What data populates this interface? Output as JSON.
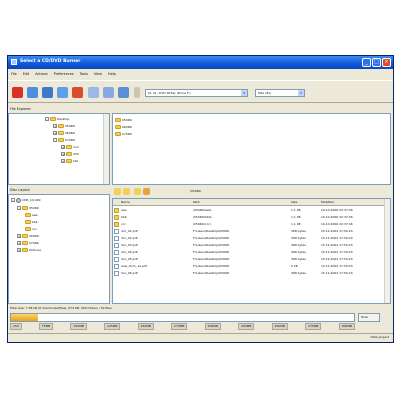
{
  "window": {
    "title": "Select a CD/DVD Burner"
  },
  "menu": [
    "File",
    "Edit",
    "Actions",
    "Preferences",
    "Tools",
    "View",
    "Help"
  ],
  "toolbar": {
    "drive_combo": "[0, 0] - DVD Writer (Drive F:)",
    "speed_combo": "Max (8x)"
  },
  "file_explorer": {
    "title": "File Explorer",
    "tree": [
      {
        "label": "Desktop",
        "level": 0
      },
      {
        "label": "0506D",
        "level": 1
      },
      {
        "label": "0606D",
        "level": 1
      },
      {
        "label": "0706D",
        "level": 1
      },
      {
        "label": "nnn",
        "level": 2
      },
      {
        "label": "ddd",
        "level": 2
      },
      {
        "label": "kkk",
        "level": 2
      }
    ],
    "files": [
      "0506D",
      "0606D",
      "0706D"
    ]
  },
  "disc_layout": {
    "title": "Disc Layout",
    "path": "\\0506D",
    "tree": [
      {
        "label": "CDR_1/1409",
        "level": 0
      },
      {
        "label": "0506D",
        "level": 1
      },
      {
        "label": "aaa",
        "level": 2
      },
      {
        "label": "bbb",
        "level": 2
      },
      {
        "label": "ccc",
        "level": 2
      },
      {
        "label": "0606D",
        "level": 1
      },
      {
        "label": "0706D",
        "level": 1
      },
      {
        "label": "Pictures",
        "level": 1
      }
    ],
    "columns": [
      "Name",
      "Path",
      "Size",
      "Modified"
    ],
    "rows": [
      {
        "name": "aaa",
        "path": "\\0506D\\aaa\\",
        "size": "1.1 kB",
        "modified": "10.10.2006 22:37:46"
      },
      {
        "name": "bbb",
        "path": "\\0506D\\bbb\\",
        "size": "1.1 kB",
        "modified": "10.10.2006 22:37:46"
      },
      {
        "name": "ccc",
        "path": "\\0506D\\ccc\\",
        "size": "1.1 kB",
        "modified": "10.10.2006 22:37:46"
      },
      {
        "name": "doc_01.pdf",
        "path": "F:\\Users\\Desktop\\0506D",
        "size": "368 bytes",
        "modified": "15.12.2004 17:50:24"
      },
      {
        "name": "doc_02.pdf",
        "path": "F:\\Users\\Desktop\\0506D",
        "size": "368 bytes",
        "modified": "15.12.2004 17:50:24"
      },
      {
        "name": "doc_03.pdf",
        "path": "F:\\Users\\Desktop\\0506D",
        "size": "368 bytes",
        "modified": "15.12.2004 17:50:24"
      },
      {
        "name": "doc_04.pdf",
        "path": "F:\\Users\\Desktop\\0506D",
        "size": "368 bytes",
        "modified": "15.12.2004 17:50:24"
      },
      {
        "name": "doc_05.pdf",
        "path": "F:\\Users\\Desktop\\0506D",
        "size": "368 bytes",
        "modified": "15.12.2004 17:50:24"
      },
      {
        "name": "new_form_1a.pdf",
        "path": "F:\\Users\\Desktop\\0506D",
        "size": "0 kB",
        "modified": "15.12.2004 17:50:24"
      },
      {
        "name": "doc_06.pdf",
        "path": "F:\\Users\\Desktop\\0506D",
        "size": "368 bytes",
        "modified": "15.12.2004 17:50:24"
      }
    ]
  },
  "status": {
    "summary": "Total size: 7,38 kB (6 directories/files), 674 KB, 450 folders / 59 files",
    "progress_fraction": 0.08,
    "ticks": [
      "150",
      "75MB",
      "100MB",
      "125MB",
      "150MB",
      "175MB",
      "200MB",
      "225MB",
      "250MB",
      "275MB",
      "300MB"
    ],
    "hide_label": "Hide",
    "bottom_right": "Data project"
  }
}
